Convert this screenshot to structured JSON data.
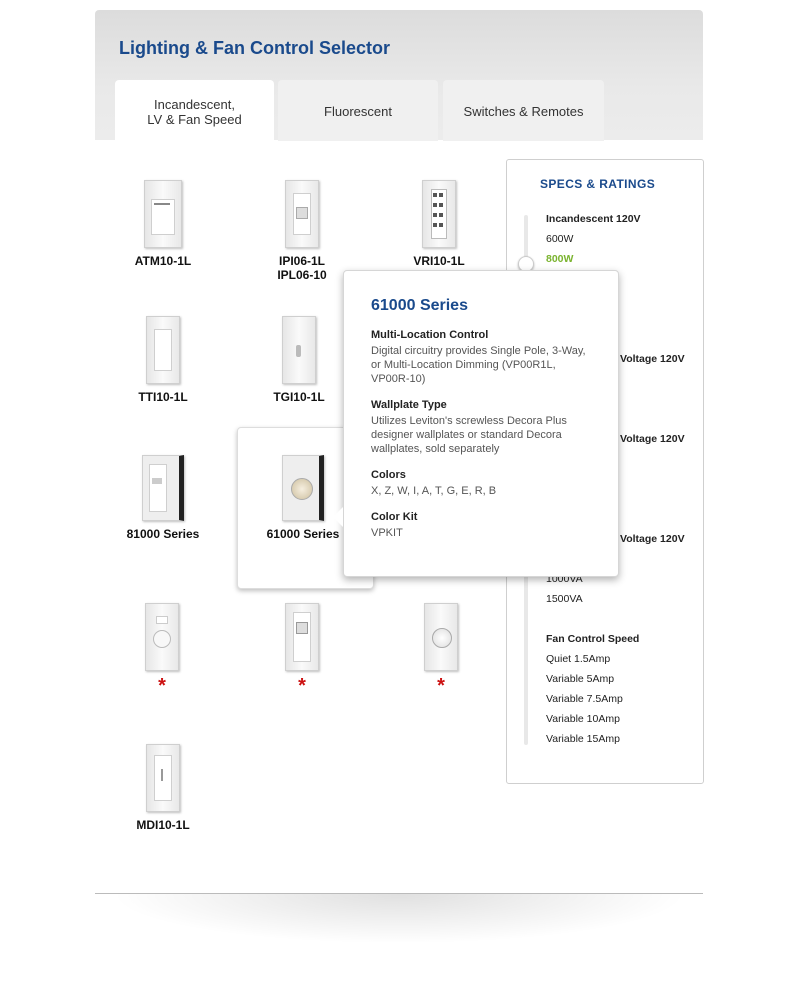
{
  "header": {
    "title": "Lighting & Fan Control Selector"
  },
  "tabs": [
    {
      "label": "Incandescent,\nLV & Fan Speed",
      "active": true
    },
    {
      "label": "Fluorescent",
      "active": false
    },
    {
      "label": "Switches & Remotes",
      "active": false
    }
  ],
  "products": [
    {
      "label": "ATM10-1L"
    },
    {
      "label": "IPI06-1L\nIPL06-10"
    },
    {
      "label": "VRI10-1L"
    },
    {
      "label": "TTI10-1L"
    },
    {
      "label": "TGI10-1L"
    },
    {
      "label": "81000 Series"
    },
    {
      "label": "61000 Series"
    },
    {
      "label": "*"
    },
    {
      "label": "*"
    },
    {
      "label": "*"
    },
    {
      "label": "MDI10-1L"
    }
  ],
  "specs": {
    "title": "SPECS & RATINGS",
    "incandescent_heading": "Incandescent 120V",
    "incandescent_items": [
      "600W",
      "800W"
    ],
    "selected_item": "800W",
    "voltage_headings": [
      "Voltage 120V",
      "Voltage 120V",
      "Voltage 120V"
    ],
    "va_items": [
      "1000VA",
      "1500VA"
    ],
    "fan_heading": "Fan Control Speed",
    "fan_items": [
      "Quiet 1.5Amp",
      "Variable 5Amp",
      "Variable 7.5Amp",
      "Variable 10Amp",
      "Variable 15Amp"
    ],
    "colors": {
      "accent": "#1a4a8c",
      "selected": "#7ab32e"
    }
  },
  "popup": {
    "title": "61000 Series",
    "sections": [
      {
        "heading": "Multi-Location Control",
        "text": "Digital circuitry provides Single Pole, 3-Way, or Multi-Location Dimming (VP00R1L, VP00R-10)"
      },
      {
        "heading": "Wallplate Type",
        "text": "Utilizes Leviton's screwless Decora Plus designer wallplates or standard Decora wallplates, sold separately"
      },
      {
        "heading": "Colors",
        "text": "X, Z, W, I, A, T, G, E, R, B"
      },
      {
        "heading": "Color Kit",
        "text": "VPKIT"
      }
    ]
  }
}
